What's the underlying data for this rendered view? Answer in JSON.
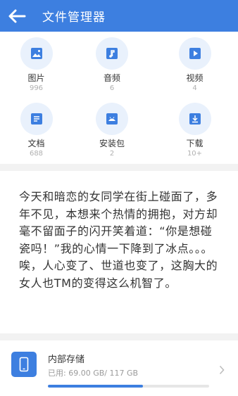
{
  "header": {
    "title": "文件管理器"
  },
  "categories": [
    {
      "label": "图片",
      "count": "996",
      "icon": "image-icon"
    },
    {
      "label": "音频",
      "count": "6",
      "icon": "music-icon"
    },
    {
      "label": "视频",
      "count": "4",
      "icon": "video-icon"
    },
    {
      "label": "文档",
      "count": "688",
      "icon": "document-icon"
    },
    {
      "label": "安装包",
      "count": "2",
      "icon": "package-icon"
    },
    {
      "label": "下载",
      "count": "10+",
      "icon": "download-icon"
    }
  ],
  "article": {
    "text": "今天和暗恋的女同学在街上碰面了，多年不见，本想来个热情的拥抱，对方却毫不留面子的闪开笑着道：“你是想碰瓷吗！”我的心情一下降到了冰点。。。唉，人心变了、世道也变了，这胸大的女人也TM的变得这么机智了。"
  },
  "storage": {
    "name": "内部存储",
    "used": "已用: 69.00 GB/ 117 GB",
    "used_fraction": 0.59
  },
  "colors": {
    "accent": "#3d7fe0",
    "icon_bg": "#e9f1fc"
  }
}
